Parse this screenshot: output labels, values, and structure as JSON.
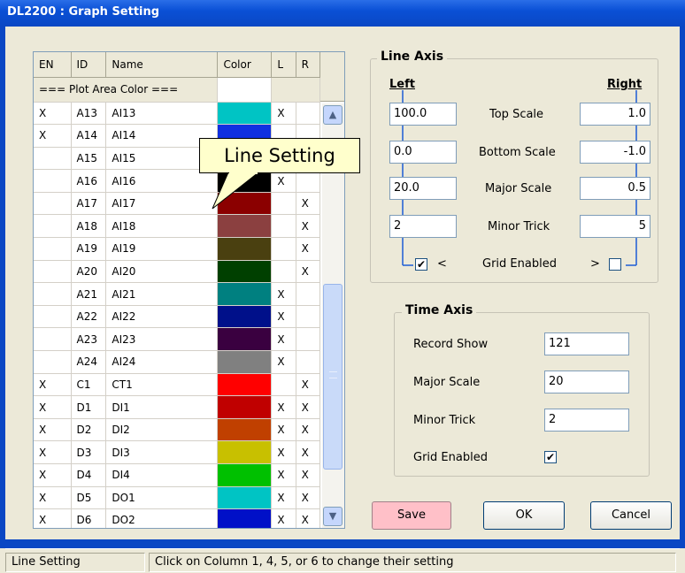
{
  "window": {
    "title": "DL2200 : Graph Setting"
  },
  "grid": {
    "columns": [
      "EN",
      "ID",
      "Name",
      "Color",
      "L",
      "R"
    ],
    "plot_area_label": "=== Plot Area Color ===",
    "plot_area_color": "#ffffff",
    "rows": [
      {
        "en": "X",
        "id": "A13",
        "name": "AI13",
        "color": "#00c4c4",
        "l": "X",
        "r": ""
      },
      {
        "en": "X",
        "id": "A14",
        "name": "AI14",
        "color": "#1030e0",
        "l": "",
        "r": ""
      },
      {
        "en": "",
        "id": "A15",
        "name": "AI15",
        "color": "#b0b0b0",
        "l": "",
        "r": ""
      },
      {
        "en": "",
        "id": "A16",
        "name": "AI16",
        "color": "#000000",
        "l": "X",
        "r": ""
      },
      {
        "en": "",
        "id": "A17",
        "name": "AI17",
        "color": "#8b0000",
        "l": "",
        "r": "X"
      },
      {
        "en": "",
        "id": "A18",
        "name": "AI18",
        "color": "#8b4040",
        "l": "",
        "r": "X"
      },
      {
        "en": "",
        "id": "A19",
        "name": "AI19",
        "color": "#4a4010",
        "l": "",
        "r": "X"
      },
      {
        "en": "",
        "id": "A20",
        "name": "AI20",
        "color": "#004000",
        "l": "",
        "r": "X"
      },
      {
        "en": "",
        "id": "A21",
        "name": "AI21",
        "color": "#008080",
        "l": "X",
        "r": ""
      },
      {
        "en": "",
        "id": "A22",
        "name": "AI22",
        "color": "#00108a",
        "l": "X",
        "r": ""
      },
      {
        "en": "",
        "id": "A23",
        "name": "AI23",
        "color": "#3a0040",
        "l": "X",
        "r": ""
      },
      {
        "en": "",
        "id": "A24",
        "name": "AI24",
        "color": "#808080",
        "l": "X",
        "r": ""
      },
      {
        "en": "X",
        "id": "C1",
        "name": "CT1",
        "color": "#ff0000",
        "l": "",
        "r": "X"
      },
      {
        "en": "X",
        "id": "D1",
        "name": "DI1",
        "color": "#c00000",
        "l": "X",
        "r": "X"
      },
      {
        "en": "X",
        "id": "D2",
        "name": "DI2",
        "color": "#c04000",
        "l": "X",
        "r": "X"
      },
      {
        "en": "X",
        "id": "D3",
        "name": "DI3",
        "color": "#c8c000",
        "l": "X",
        "r": "X"
      },
      {
        "en": "X",
        "id": "D4",
        "name": "DI4",
        "color": "#00c000",
        "l": "X",
        "r": "X"
      },
      {
        "en": "X",
        "id": "D5",
        "name": "DO1",
        "color": "#00c4c4",
        "l": "X",
        "r": "X"
      },
      {
        "en": "X",
        "id": "D6",
        "name": "DO2",
        "color": "#0010c8",
        "l": "X",
        "r": "X"
      }
    ]
  },
  "callout": {
    "text": "Line Setting"
  },
  "line_axis": {
    "title": "Line Axis",
    "left_label": "Left",
    "right_label": "Right",
    "top_scale": {
      "label": "Top Scale",
      "left": "100.0",
      "right": "1.0"
    },
    "bottom_scale": {
      "label": "Bottom Scale",
      "left": "0.0",
      "right": "-1.0"
    },
    "major_scale": {
      "label": "Major Scale",
      "left": "20.0",
      "right": "0.5"
    },
    "minor_trick": {
      "label": "Minor Trick",
      "left": "2",
      "right": "5"
    },
    "grid": {
      "label": "Grid Enabled",
      "lt": "<",
      "gt": ">",
      "left_checked": true,
      "right_checked": false
    }
  },
  "time_axis": {
    "title": "Time Axis",
    "record_show": {
      "label": "Record Show",
      "value": "121"
    },
    "major_scale": {
      "label": "Major Scale",
      "value": "20"
    },
    "minor_trick": {
      "label": "Minor Trick",
      "value": "2"
    },
    "grid": {
      "label": "Grid Enabled",
      "checked": true
    }
  },
  "buttons": {
    "save": "Save",
    "ok": "OK",
    "cancel": "Cancel"
  },
  "status": {
    "left": "Line Setting",
    "right": "Click on Column 1, 4, 5, or 6 to change their setting"
  },
  "icons": {
    "scroll_up": "chevron-up-icon",
    "scroll_down": "chevron-down-icon",
    "check": "checkmark-icon"
  }
}
